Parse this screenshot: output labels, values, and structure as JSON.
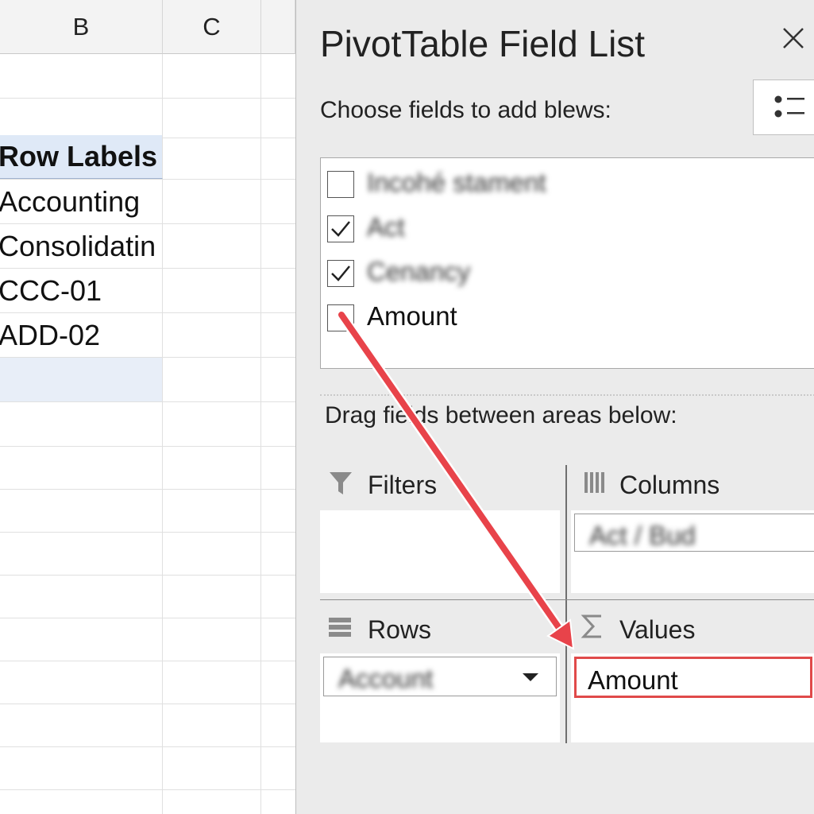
{
  "sheet": {
    "columns": [
      "B",
      "C"
    ],
    "header_cell": "Row Labels",
    "rows": [
      "Accounting",
      "Consolidatin",
      "CCC-01",
      "ADD-02"
    ]
  },
  "pane": {
    "title": "PivotTable Field List",
    "close_icon": "close-icon",
    "choose_label": "Choose fields to add blews:",
    "fields": [
      {
        "label": "Incohé stament",
        "checked": false,
        "blurred": true
      },
      {
        "label": "Act",
        "checked": true,
        "blurred": true
      },
      {
        "label": "Cenancy",
        "checked": true,
        "blurred": true
      },
      {
        "label": "Amount",
        "checked": false,
        "blurred": false
      }
    ],
    "drag_label": "Drag fields between areas below:",
    "areas": {
      "filters": {
        "title": "Filters",
        "icon": "filter-icon"
      },
      "columns": {
        "title": "Columns",
        "icon": "columns-icon",
        "item": "Act / Bud"
      },
      "rows": {
        "title": "Rows",
        "icon": "rows-icon",
        "item": "Account"
      },
      "values": {
        "title": "Values",
        "icon": "sigma-icon",
        "item": "Amount"
      }
    }
  },
  "colors": {
    "arrow": "#e8434a",
    "highlight_border": "#e04a4a",
    "header_fill": "#dfe9f7"
  }
}
